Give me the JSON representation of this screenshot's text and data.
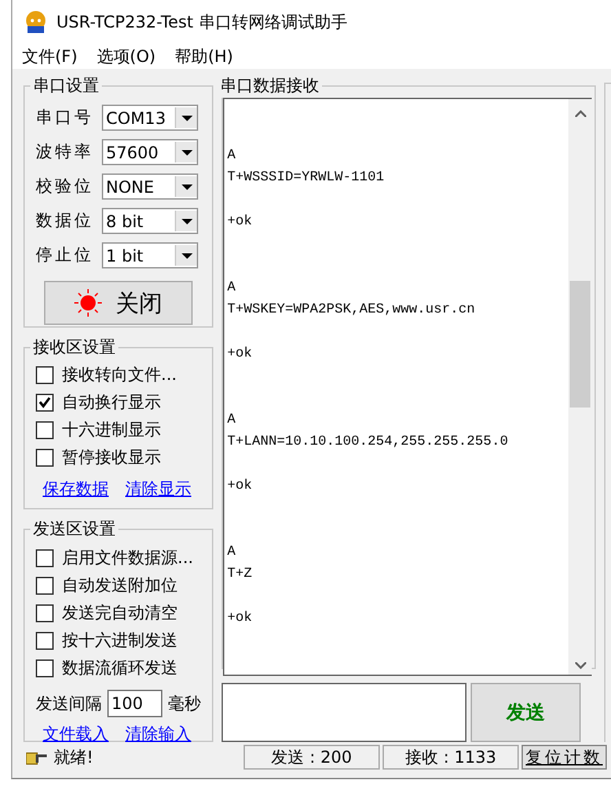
{
  "window": {
    "title": "USR-TCP232-Test 串口转网络调试助手"
  },
  "menu": [
    "文件(F)",
    "选项(O)",
    "帮助(H)"
  ],
  "serial_settings": {
    "title": "串口设置",
    "fields": [
      {
        "label": "串口号",
        "value": "COM13"
      },
      {
        "label": "波特率",
        "value": "57600"
      },
      {
        "label": "校验位",
        "value": "NONE"
      },
      {
        "label": "数据位",
        "value": "8 bit"
      },
      {
        "label": "停止位",
        "value": "1 bit"
      }
    ],
    "button": {
      "label": "关闭",
      "on": true
    }
  },
  "receive_settings": {
    "title": "接收区设置",
    "options": [
      {
        "label": "接收转向文件...",
        "checked": false
      },
      {
        "label": "自动换行显示",
        "checked": true
      },
      {
        "label": "十六进制显示",
        "checked": false
      },
      {
        "label": "暂停接收显示",
        "checked": false
      }
    ],
    "links": [
      "保存数据",
      "清除显示"
    ]
  },
  "send_settings": {
    "title": "发送区设置",
    "options": [
      {
        "label": "启用文件数据源...",
        "checked": false
      },
      {
        "label": "自动发送附加位",
        "checked": false
      },
      {
        "label": "发送完自动清空",
        "checked": false
      },
      {
        "label": "按十六进制发送",
        "checked": false
      },
      {
        "label": "数据流循环发送",
        "checked": false
      }
    ],
    "interval": {
      "label": "发送间隔",
      "value": "100",
      "unit": "毫秒"
    },
    "links": [
      "文件载入",
      "清除输入"
    ]
  },
  "receive_panel": {
    "title": "串口数据接收",
    "blocks": [
      {
        "echo": [
          "A",
          "T+WSSSID=YRWLW-1101"
        ],
        "reply": "+ok"
      },
      {
        "echo": [
          "A",
          "T+WSKEY=WPA2PSK,AES,www.usr.cn"
        ],
        "reply": "+ok"
      },
      {
        "echo": [
          "A",
          "T+LANN=10.10.100.254,255.255.255.0"
        ],
        "reply": "+ok"
      },
      {
        "echo": [
          "A",
          "T+Z"
        ],
        "reply": "+ok"
      }
    ]
  },
  "send_panel": {
    "button": "发送"
  },
  "status_bar": {
    "message": "就绪!",
    "sent": "发送 : 200",
    "received": "接收 : 1133",
    "reset": "复位计数"
  }
}
